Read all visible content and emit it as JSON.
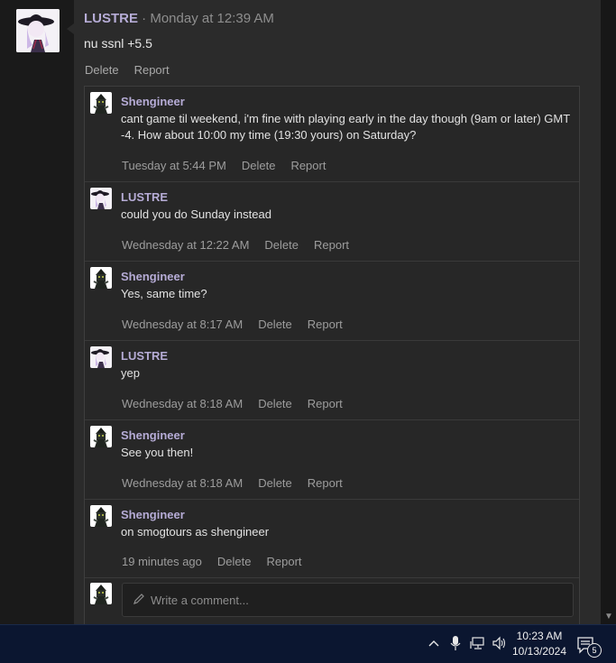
{
  "post": {
    "author": "LUSTRE",
    "separator": " · ",
    "timestamp": "Monday at 12:39 AM",
    "body": "nu ssnl +5.5",
    "delete_label": "Delete",
    "report_label": "Report"
  },
  "comments": [
    {
      "author": "Shengineer",
      "text": "cant game til weekend, i'm fine with playing early in the day though (9am or later) GMT -4. How about 10:00 my time (19:30 yours) on Saturday?",
      "time": "Tuesday at 5:44 PM",
      "delete": "Delete",
      "report": "Report",
      "avatar": "shengineer"
    },
    {
      "author": "LUSTRE",
      "text": "could you do Sunday instead",
      "time": "Wednesday at 12:22 AM",
      "delete": "Delete",
      "report": "Report",
      "avatar": "lustre"
    },
    {
      "author": "Shengineer",
      "text": "Yes, same time?",
      "time": "Wednesday at 8:17 AM",
      "delete": "Delete",
      "report": "Report",
      "avatar": "shengineer"
    },
    {
      "author": "LUSTRE",
      "text": "yep",
      "time": "Wednesday at 8:18 AM",
      "delete": "Delete",
      "report": "Report",
      "avatar": "lustre"
    },
    {
      "author": "Shengineer",
      "text": "See you then!",
      "time": "Wednesday at 8:18 AM",
      "delete": "Delete",
      "report": "Report",
      "avatar": "shengineer"
    },
    {
      "author": "Shengineer",
      "text": "on smogtours as shengineer",
      "time": "19 minutes ago",
      "delete": "Delete",
      "report": "Report",
      "avatar": "shengineer"
    }
  ],
  "composer": {
    "placeholder": "Write a comment..."
  },
  "taskbar": {
    "time": "10:23 AM",
    "date": "10/13/2024",
    "notification_count": "5"
  }
}
